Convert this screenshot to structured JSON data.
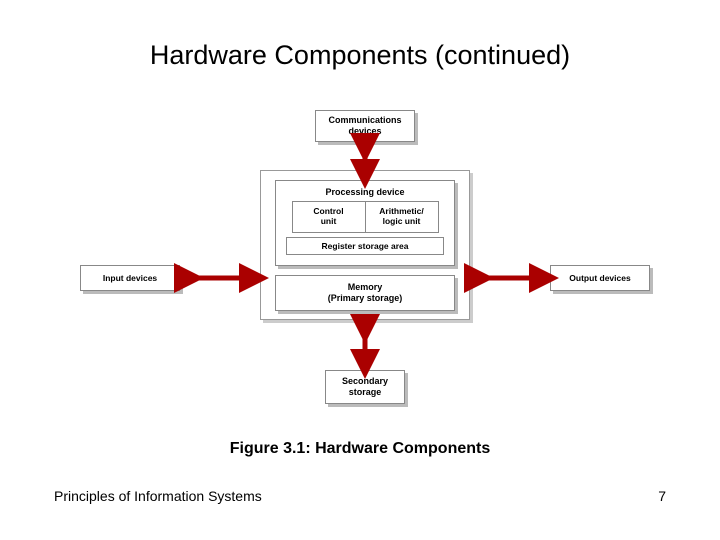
{
  "title": "Hardware Components (continued)",
  "caption": "Figure 3.1: Hardware Components",
  "footer_left": "Principles of Information Systems",
  "footer_right": "7",
  "diagram": {
    "comm_l1": "Communications",
    "comm_l2": "devices",
    "proc_title": "Processing device",
    "control_l1": "Control",
    "control_l2": "unit",
    "alu_l1": "Arithmetic/",
    "alu_l2": "logic unit",
    "register": "Register storage area",
    "memory_l1": "Memory",
    "memory_l2": "(Primary storage)",
    "input": "Input devices",
    "output": "Output devices",
    "secondary_l1": "Secondary",
    "secondary_l2": "storage"
  }
}
